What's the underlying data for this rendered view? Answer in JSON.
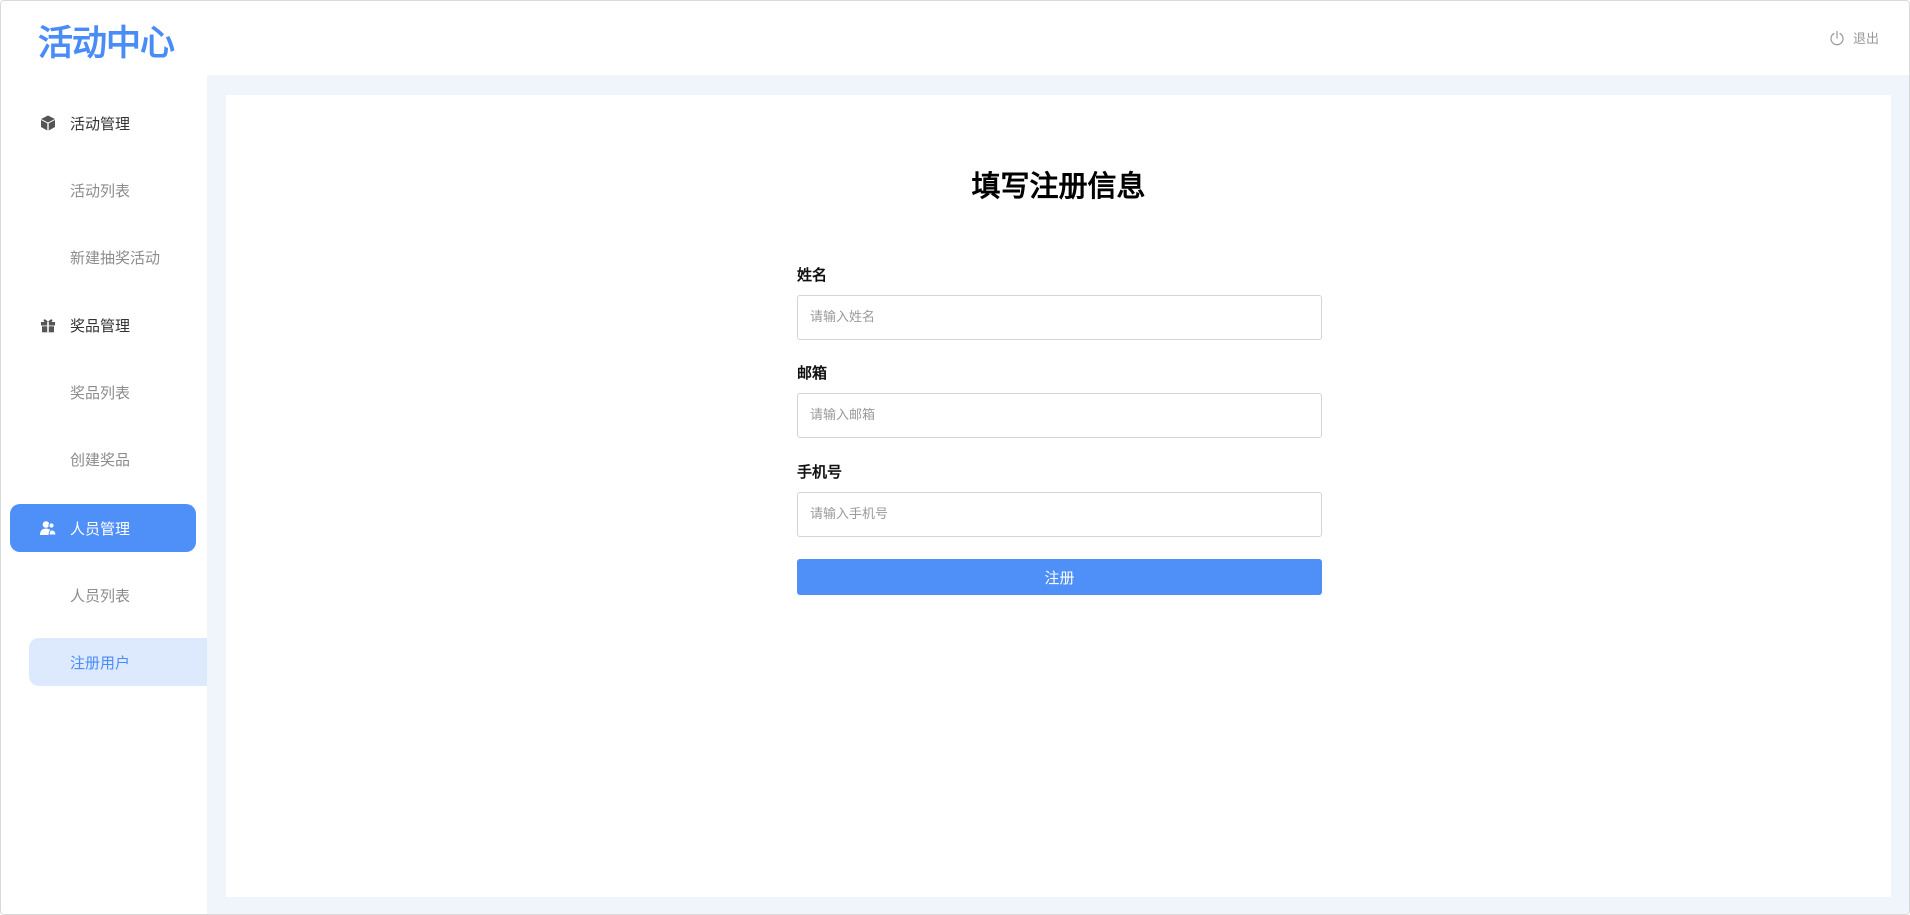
{
  "app": {
    "logo": "活动中心",
    "logout_label": "退出"
  },
  "sidebar": {
    "groups": [
      {
        "label": "活动管理",
        "icon": "cube-icon",
        "items": [
          {
            "label": "活动列表"
          },
          {
            "label": "新建抽奖活动"
          }
        ]
      },
      {
        "label": "奖品管理",
        "icon": "gift-icon",
        "items": [
          {
            "label": "奖品列表"
          },
          {
            "label": "创建奖品"
          }
        ]
      },
      {
        "label": "人员管理",
        "icon": "users-icon",
        "active": true,
        "items": [
          {
            "label": "人员列表"
          },
          {
            "label": "注册用户",
            "selected": true
          }
        ]
      }
    ]
  },
  "form": {
    "title": "填写注册信息",
    "name": {
      "label": "姓名",
      "placeholder": "请输入姓名",
      "value": ""
    },
    "email": {
      "label": "邮箱",
      "placeholder": "请输入邮箱",
      "value": ""
    },
    "phone": {
      "label": "手机号",
      "placeholder": "请输入手机号",
      "value": ""
    },
    "submit_label": "注册"
  },
  "colors": {
    "accent": "#4f8ff8",
    "selected_bg": "#dde9fd",
    "content_bg": "#f0f4fb"
  }
}
